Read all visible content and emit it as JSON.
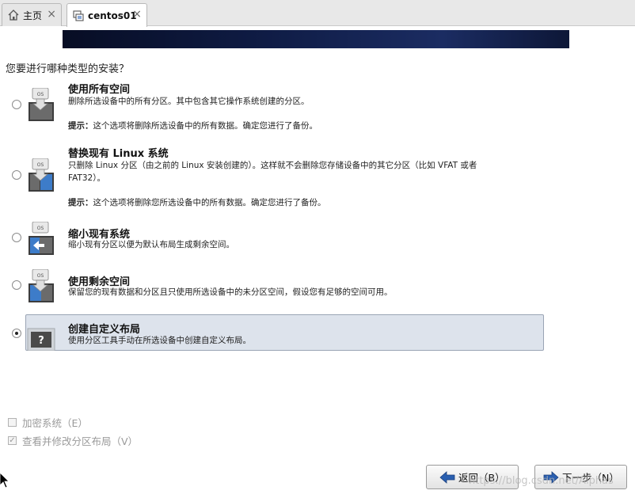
{
  "tabs": [
    {
      "label": "主页",
      "icon": "home-icon",
      "active": false
    },
    {
      "label": "centos01",
      "icon": "vm-icon",
      "active": true
    }
  ],
  "tab_close_glyph": "×",
  "installer": {
    "question": "您要进行哪种类型的安装？",
    "options": [
      {
        "title": "使用所有空间",
        "desc": "删除所选设备中的所有分区。其中包含其它操作系统创建的分区。",
        "hint_label": "提示：",
        "hint_text": "这个选项将删除所选设备中的所有数据。确定您进行了备份。",
        "icon_badge": "OS",
        "icon": "use-all-space-icon",
        "selected": false
      },
      {
        "title": "替换现有 Linux 系统",
        "desc": "只删除 Linux 分区（由之前的 Linux 安装创建的）。这样就不会删除您存储设备中的其它分区（比如 VFAT 或者 FAT32）。",
        "hint_label": "提示：",
        "hint_text": "这个选项将删除您所选设备中的所有数据。确定您进行了备份。",
        "icon_badge": "OS",
        "icon": "replace-linux-icon",
        "selected": false
      },
      {
        "title": "缩小现有系统",
        "desc": "缩小现有分区以便为默认布局生成剩余空间。",
        "icon_badge": "OS",
        "icon": "shrink-system-icon",
        "selected": false
      },
      {
        "title": "使用剩余空间",
        "desc": "保留您的现有数据和分区且只使用所选设备中的未分区空间，假设您有足够的空间可用。",
        "icon_badge": "OS",
        "icon": "use-free-space-icon",
        "selected": false
      },
      {
        "title": "创建自定义布局",
        "desc": "使用分区工具手动在所选设备中创建自定义布局。",
        "icon_badge": "?",
        "icon": "custom-layout-icon",
        "selected": true
      }
    ],
    "encrypt": {
      "label": "加密系统（E）",
      "checked": false,
      "enabled": false
    },
    "review": {
      "label": "查看并修改分区布局（V）",
      "checked": true,
      "enabled": false
    },
    "back_label": "返回（B）",
    "next_label": "下一步（N）",
    "watermark": "https://blog.csdn.net/Alphas"
  },
  "colors": {
    "banner": "#0f1c45",
    "selected_row": "#dde3ec",
    "arrow_blue": "#2a5fb0"
  }
}
